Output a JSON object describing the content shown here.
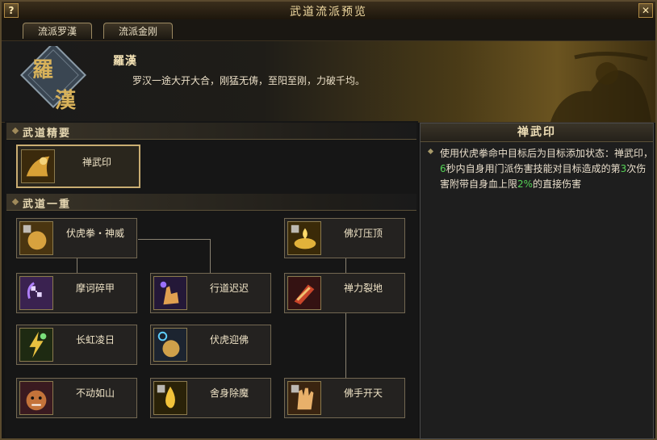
{
  "window": {
    "title": "武道流派预览",
    "help_label": "?",
    "close_label": "✕"
  },
  "tabs": [
    {
      "label": "流派罗漢"
    },
    {
      "label": "流派金刚"
    }
  ],
  "banner": {
    "emblem_top": "羅",
    "emblem_bottom": "漢",
    "name": "羅漢",
    "description": "罗汉一途大开大合，刚猛无俦，至阳至刚，力破千均。"
  },
  "sections": {
    "essentials": "武道精要",
    "tier1": "武道一重"
  },
  "essential_skill": {
    "name": "禅武印",
    "icon": "fist-gold-icon"
  },
  "skills": [
    {
      "name": "伏虎拳・神威",
      "icon": "fist-icon"
    },
    {
      "name": "摩诃碎甲",
      "icon": "swastika-icon"
    },
    {
      "name": "长虹凌日",
      "icon": "lightning-icon"
    },
    {
      "name": "不动如山",
      "icon": "tiger-icon"
    },
    {
      "name": "行道迟迟",
      "icon": "palm-icon"
    },
    {
      "name": "伏虎迎佛",
      "icon": "fist-icon"
    },
    {
      "name": "舍身除魔",
      "icon": "flame-icon"
    },
    {
      "name": "佛灯压顶",
      "icon": "lamp-icon"
    },
    {
      "name": "禅力裂地",
      "icon": "arm-icon"
    },
    {
      "name": "佛手开天",
      "icon": "hand-icon"
    }
  ],
  "detail": {
    "title": "禅武印",
    "text_parts": [
      "使用伏虎拳命中目标后为目标添加状态：禅武印，",
      "6",
      "秒内自身用门派伤害技能对目标造成的第",
      "3",
      "次伤害附带自身血上限",
      "2%",
      "的直接伤害"
    ],
    "highlight_color": "#56d256"
  }
}
